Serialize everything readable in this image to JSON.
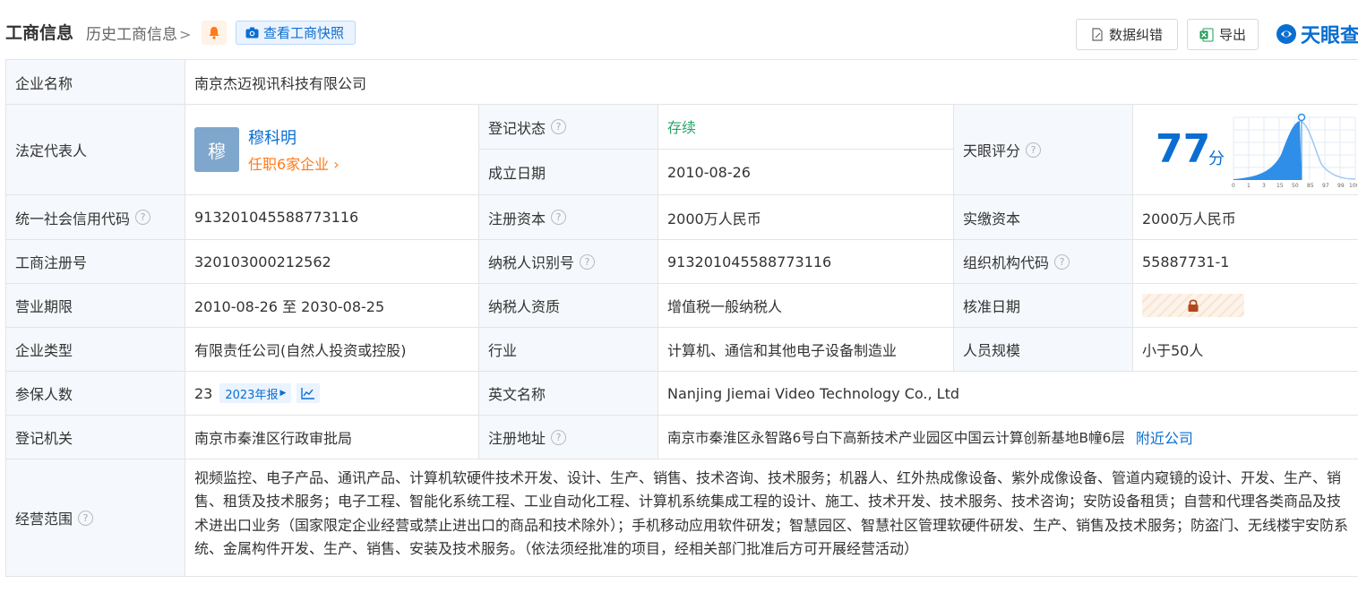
{
  "header": {
    "title": "工商信息",
    "history_label": "历史工商信息",
    "snapshot_label": "查看工商快照",
    "correct_label": "数据纠错",
    "export_label": "导出",
    "brand": "天眼查"
  },
  "rows": {
    "company_name": {
      "label": "企业名称",
      "value": "南京杰迈视讯科技有限公司"
    },
    "legal_rep": {
      "label": "法定代表人",
      "avatar_char": "穆",
      "name": "穆科明",
      "sub": "任职6家企业"
    },
    "reg_status": {
      "label": "登记状态",
      "value": "存续"
    },
    "found_date": {
      "label": "成立日期",
      "value": "2010-08-26"
    },
    "tianyan_score": {
      "label": "天眼评分",
      "value": "77",
      "unit": "分",
      "ticks": [
        "0",
        "1",
        "3",
        "15",
        "50",
        "85",
        "97",
        "99",
        "100"
      ]
    },
    "credit_code": {
      "label": "统一社会信用代码",
      "value": "913201045588773116"
    },
    "reg_capital": {
      "label": "注册资本",
      "value": "2000万人民币"
    },
    "paid_capital": {
      "label": "实缴资本",
      "value": "2000万人民币"
    },
    "reg_no": {
      "label": "工商注册号",
      "value": "320103000212562"
    },
    "taxpayer_id": {
      "label": "纳税人识别号",
      "value": "913201045588773116"
    },
    "org_code": {
      "label": "组织机构代码",
      "value": "55887731-1"
    },
    "business_term": {
      "label": "营业期限",
      "value": "2010-08-26 至 2030-08-25"
    },
    "taxpayer_quali": {
      "label": "纳税人资质",
      "value": "增值税一般纳税人"
    },
    "approval_date": {
      "label": "核准日期"
    },
    "company_type": {
      "label": "企业类型",
      "value": "有限责任公司(自然人投资或控股)"
    },
    "industry": {
      "label": "行业",
      "value": "计算机、通信和其他电子设备制造业"
    },
    "staff_size": {
      "label": "人员规模",
      "value": "小于50人"
    },
    "insured": {
      "label": "参保人数",
      "value": "23",
      "tag": "2023年报"
    },
    "english_name": {
      "label": "英文名称",
      "value": "Nanjing Jiemai Video Technology Co., Ltd"
    },
    "reg_authority": {
      "label": "登记机关",
      "value": "南京市秦淮区行政审批局"
    },
    "reg_address": {
      "label": "注册地址",
      "value": "南京市秦淮区永智路6号白下高新技术产业园区中国云计算创新基地B幢6层",
      "link": "附近公司"
    },
    "scope": {
      "label": "经营范围",
      "value": "视频监控、电子产品、通讯产品、计算机软硬件技术开发、设计、生产、销售、技术咨询、技术服务；机器人、红外热成像设备、紫外成像设备、管道内窥镜的设计、开发、生产、销售、租赁及技术服务；电子工程、智能化系统工程、工业自动化工程、计算机系统集成工程的设计、施工、技术开发、技术服务、技术咨询；安防设备租赁；自营和代理各类商品及技术进出口业务（国家限定企业经营或禁止进出口的商品和技术除外）；手机移动应用软件研发；智慧园区、智慧社区管理软硬件研发、生产、销售及技术服务；防盗门、无线楼宇安防系统、金属构件开发、生产、销售、安装及技术服务。（依法须经批准的项目，经相关部门批准后方可开展经营活动）"
    }
  },
  "colors": {
    "accent": "#0a6ed1",
    "orange": "#ff7a1a",
    "green": "#2aa36b",
    "label_bg": "#f5f8fc"
  }
}
